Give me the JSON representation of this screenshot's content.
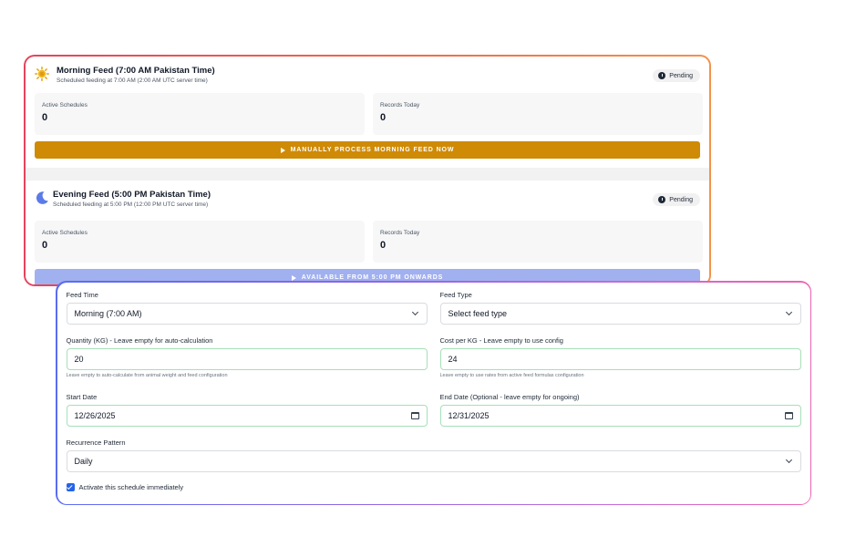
{
  "morning": {
    "title": "Morning Feed (7:00 AM Pakistan Time)",
    "subtitle": "Scheduled feeding at 7:00 AM (2:00 AM UTC server time)",
    "status": "Pending",
    "active_label": "Active Schedules",
    "active_value": "0",
    "records_label": "Records Today",
    "records_value": "0",
    "button": "MANUALLY PROCESS MORNING FEED NOW",
    "button_color": "#cf8a06",
    "icon": "sun-icon"
  },
  "evening": {
    "title": "Evening Feed (5:00 PM Pakistan Time)",
    "subtitle": "Scheduled feeding at 5:00 PM (12:00 PM UTC server time)",
    "status": "Pending",
    "active_label": "Active Schedules",
    "active_value": "0",
    "records_label": "Records Today",
    "records_value": "0",
    "button": "AVAILABLE FROM 5:00 PM ONWARDS",
    "button_color": "#a1b0ef",
    "icon": "moon-icon"
  },
  "form": {
    "feed_time_label": "Feed Time",
    "feed_time_value": "Morning (7:00 AM)",
    "feed_type_label": "Feed Type",
    "feed_type_value": "Select feed type",
    "quantity_label": "Quantity (KG) - Leave empty for auto-calculation",
    "quantity_value": "20",
    "quantity_help": "Leave empty to auto-calculate from animal weight and feed configuration",
    "cost_label": "Cost per KG - Leave empty to use config",
    "cost_value": "24",
    "cost_help": "Leave empty to use rates from active feed formulas configuration",
    "start_label": "Start Date",
    "start_value": "12/26/2025",
    "end_label": "End Date (Optional - leave empty for ongoing)",
    "end_value": "12/31/2025",
    "recurrence_label": "Recurrence Pattern",
    "recurrence_value": "Daily",
    "activate_label": "Activate this schedule immediately",
    "activate_checked": true
  },
  "colors": {
    "accent_orange": "#cf8a06",
    "accent_blue": "#2563eb",
    "field_valid_border": "#a7dfb9"
  }
}
